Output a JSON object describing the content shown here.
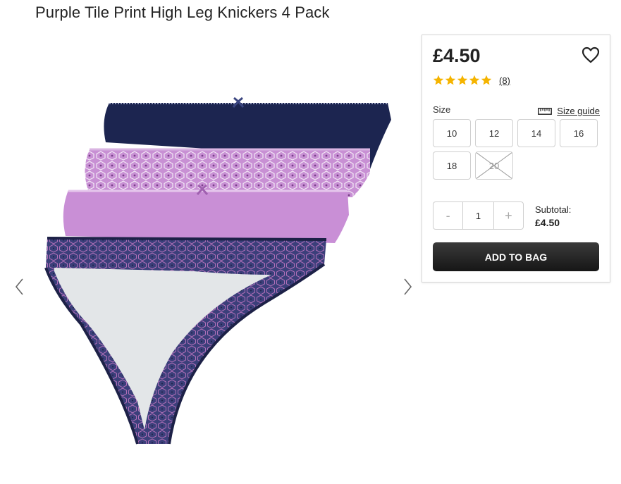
{
  "product": {
    "title": "Purple Tile Print High Leg Knickers 4 Pack",
    "price": "£4.50",
    "rating": 5,
    "review_count": "(8)"
  },
  "size_section": {
    "label": "Size",
    "guide_label": "Size guide",
    "sizes": [
      {
        "label": "10",
        "available": true
      },
      {
        "label": "12",
        "available": true
      },
      {
        "label": "14",
        "available": true
      },
      {
        "label": "16",
        "available": true
      },
      {
        "label": "18",
        "available": true
      },
      {
        "label": "20",
        "available": false
      }
    ]
  },
  "quantity": {
    "decrement": "-",
    "value": "1",
    "increment": "+"
  },
  "subtotal": {
    "label": "Subtotal:",
    "value": "£4.50"
  },
  "add_to_bag_label": "ADD TO BAG",
  "icons": {
    "wishlist": "heart-icon",
    "size_guide": "ruler-icon",
    "prev": "chevron-left-icon",
    "next": "chevron-right-icon",
    "star": "star-icon"
  },
  "colors": {
    "star": "#f5b400",
    "button": "#222222",
    "navy": "#1c2550",
    "lilac": "#c98fd6"
  }
}
